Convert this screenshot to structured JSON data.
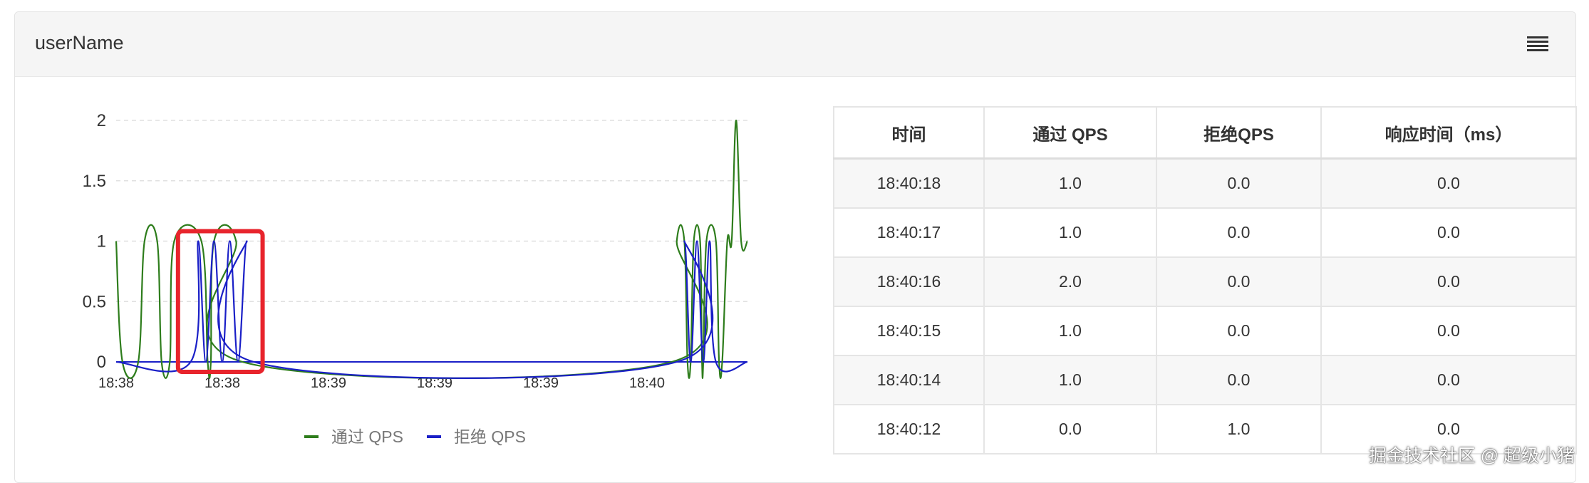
{
  "panel": {
    "title": "userName"
  },
  "icons": {
    "menu": "list-menu-icon"
  },
  "colors": {
    "pass": "#2e7d1c",
    "block": "#1a1fc7",
    "highlight": "#e8242c",
    "grid": "#e0e0e0"
  },
  "chart_data": {
    "type": "line",
    "x_ticks": [
      "18:38",
      "18:38",
      "18:39",
      "18:39",
      "18:39",
      "18:40"
    ],
    "y_ticks": [
      "0",
      "0.5",
      "1",
      "1.5",
      "2"
    ],
    "ylim": [
      0,
      2
    ],
    "grid": "horizontal-dashed",
    "legend_position": "bottom",
    "series": [
      {
        "name": "通过 QPS",
        "color": "#2e7d1c",
        "points": [
          [
            0,
            1
          ],
          [
            0.01,
            0
          ],
          [
            0.035,
            0
          ],
          [
            0.045,
            1
          ],
          [
            0.065,
            1
          ],
          [
            0.072,
            0
          ],
          [
            0.085,
            0
          ],
          [
            0.092,
            1
          ],
          [
            0.135,
            1
          ],
          [
            0.145,
            0
          ],
          [
            0.15,
            0
          ],
          [
            0.155,
            1
          ],
          [
            0.19,
            1
          ],
          [
            0.2,
            0
          ],
          [
            0.88,
            0
          ],
          [
            0.888,
            1
          ],
          [
            0.9,
            1
          ],
          [
            0.905,
            0
          ],
          [
            0.91,
            0
          ],
          [
            0.915,
            1
          ],
          [
            0.925,
            1
          ],
          [
            0.928,
            0
          ],
          [
            0.93,
            0
          ],
          [
            0.935,
            1
          ],
          [
            0.95,
            1
          ],
          [
            0.955,
            0
          ],
          [
            0.96,
            0
          ],
          [
            0.968,
            1
          ],
          [
            0.975,
            1
          ],
          [
            0.982,
            2
          ],
          [
            0.99,
            1
          ],
          [
            1,
            1
          ]
        ]
      },
      {
        "name": "拒绝 QPS",
        "color": "#1a1fc7",
        "points": [
          [
            0,
            0
          ],
          [
            0.118,
            0
          ],
          [
            0.13,
            1
          ],
          [
            0.142,
            0
          ],
          [
            0.155,
            1
          ],
          [
            0.168,
            0
          ],
          [
            0.18,
            1
          ],
          [
            0.193,
            0
          ],
          [
            0.207,
            1
          ],
          [
            0.218,
            0
          ],
          [
            0.888,
            0
          ],
          [
            0.9,
            1
          ],
          [
            0.91,
            0
          ],
          [
            0.92,
            1
          ],
          [
            0.93,
            0
          ],
          [
            0.94,
            1
          ],
          [
            0.95,
            0
          ],
          [
            1,
            0
          ]
        ]
      }
    ]
  },
  "table": {
    "headers": [
      "时间",
      "通过 QPS",
      "拒绝QPS",
      "响应时间（ms）"
    ],
    "rows": [
      [
        "18:40:18",
        "1.0",
        "0.0",
        "0.0"
      ],
      [
        "18:40:17",
        "1.0",
        "0.0",
        "0.0"
      ],
      [
        "18:40:16",
        "2.0",
        "0.0",
        "0.0"
      ],
      [
        "18:40:15",
        "1.0",
        "0.0",
        "0.0"
      ],
      [
        "18:40:14",
        "1.0",
        "0.0",
        "0.0"
      ],
      [
        "18:40:12",
        "0.0",
        "1.0",
        "0.0"
      ]
    ]
  },
  "watermark": "掘金技术社区 @ 超级小猪"
}
